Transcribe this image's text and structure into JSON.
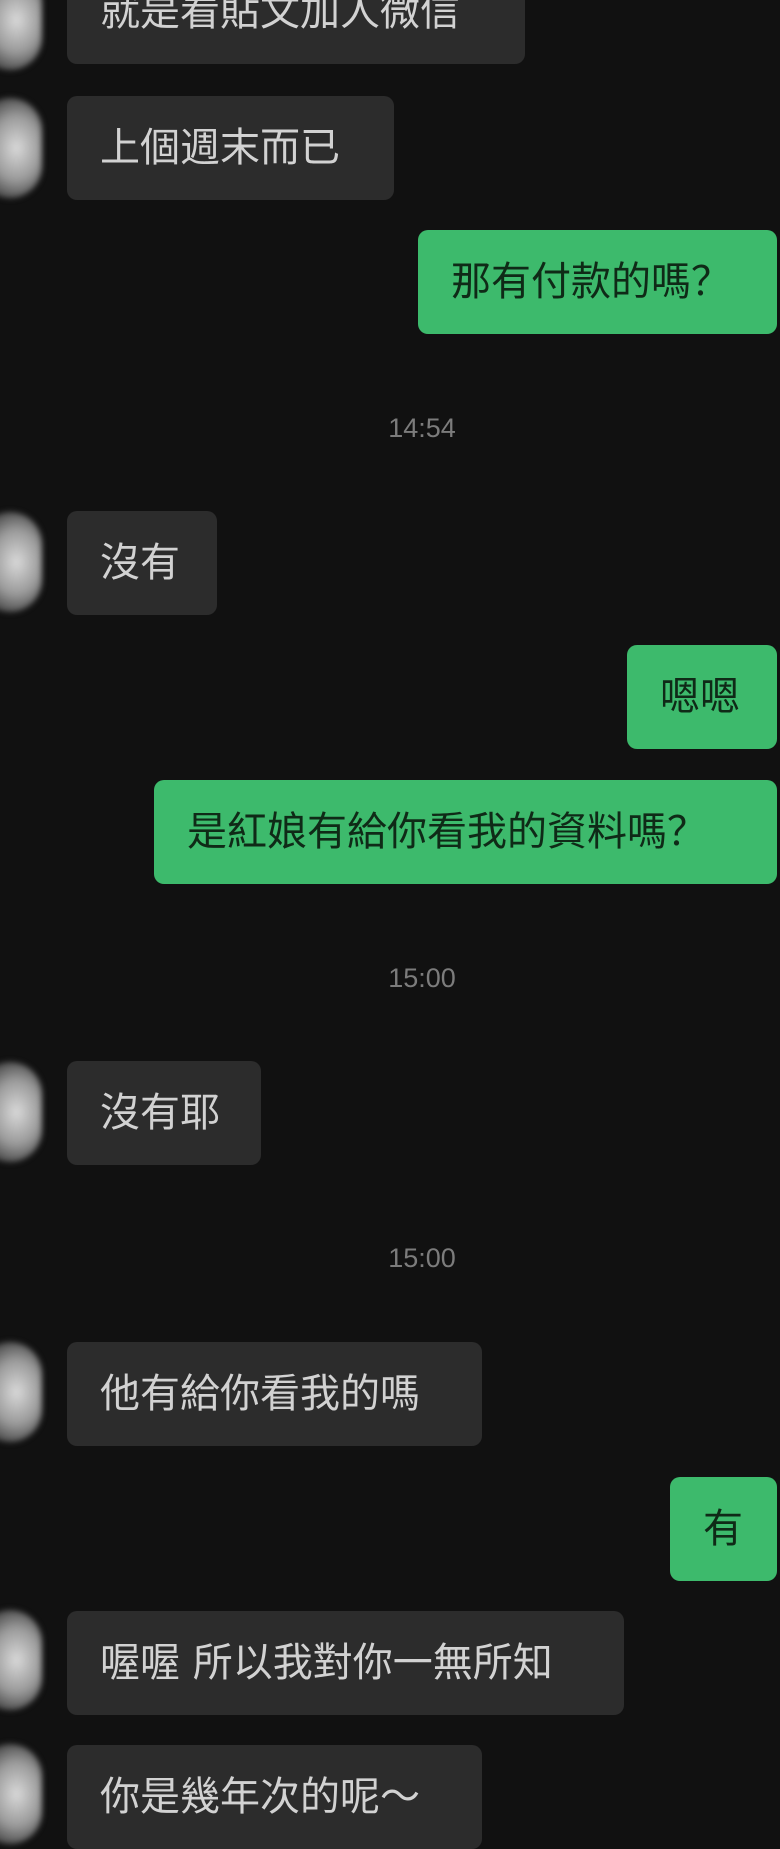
{
  "chat": {
    "messages": [
      {
        "side": "in",
        "text": "就是看貼文加人微信"
      },
      {
        "side": "in",
        "text": "上個週末而已"
      },
      {
        "side": "out",
        "text": "那有付款的嗎？"
      },
      {
        "side": "time",
        "text": "14:54"
      },
      {
        "side": "in",
        "text": "沒有"
      },
      {
        "side": "out",
        "text": "嗯嗯"
      },
      {
        "side": "out",
        "text": "是紅娘有給你看我的資料嗎？"
      },
      {
        "side": "time",
        "text": "15:00"
      },
      {
        "side": "in",
        "text": "沒有耶"
      },
      {
        "side": "time",
        "text": "15:00"
      },
      {
        "side": "in",
        "text": "他有給你看我的嗎"
      },
      {
        "side": "out",
        "text": "有"
      },
      {
        "side": "in",
        "text": "喔喔 所以我對你一無所知"
      },
      {
        "side": "in",
        "text": "你是幾年次的呢～"
      }
    ]
  }
}
